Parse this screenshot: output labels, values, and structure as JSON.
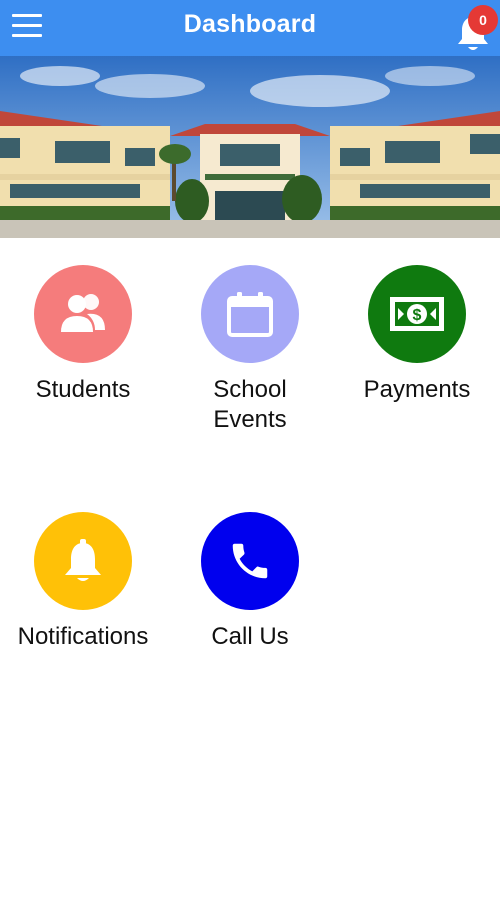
{
  "header": {
    "title": "Dashboard",
    "notification_count": "0",
    "bg_color": "#3d8ef0",
    "badge_color": "#e53935"
  },
  "tiles": [
    {
      "label": "Students",
      "icon": "students-icon",
      "color": "#f57c7c"
    },
    {
      "label": "School\nEvents",
      "icon": "calendar-icon",
      "color": "#a5a8f7"
    },
    {
      "label": "Payments",
      "icon": "money-icon",
      "color": "#0f7a0f"
    },
    {
      "label": "Notifications",
      "icon": "bell-icon",
      "color": "#ffc107"
    },
    {
      "label": "Call Us",
      "icon": "phone-icon",
      "color": "#0000ee"
    }
  ]
}
